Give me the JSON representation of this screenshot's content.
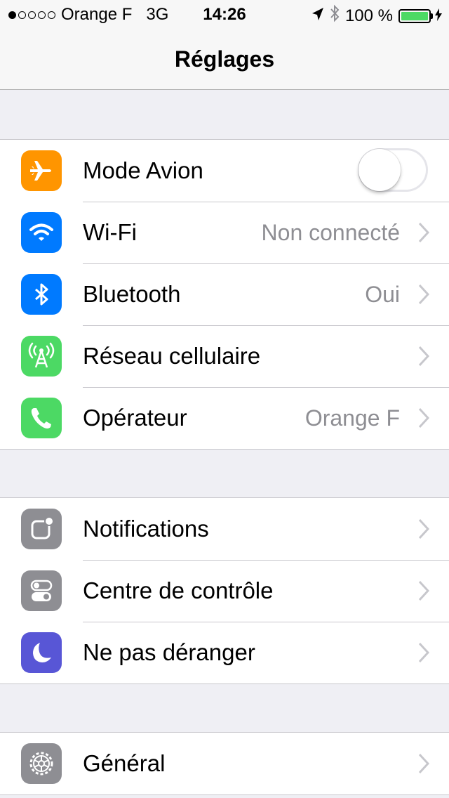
{
  "status_bar": {
    "signal_dots_filled": 1,
    "signal_dots_total": 5,
    "carrier": "Orange F",
    "network": "3G",
    "time": "14:26",
    "battery": "100 %",
    "battery_level": 1.0
  },
  "nav": {
    "title": "Réglages"
  },
  "groups": [
    {
      "rows": [
        {
          "label": "Mode Avion",
          "icon": "airplane-icon",
          "color": "#ff9500",
          "toggle": false
        },
        {
          "label": "Wi-Fi",
          "icon": "wifi-icon",
          "color": "#007aff",
          "detail": "Non connecté"
        },
        {
          "label": "Bluetooth",
          "icon": "bluetooth-icon",
          "color": "#007aff",
          "detail": "Oui"
        },
        {
          "label": "Réseau cellulaire",
          "icon": "cellular-antenna-icon",
          "color": "#4cd964"
        },
        {
          "label": "Opérateur",
          "icon": "phone-icon",
          "color": "#4cd964",
          "detail": "Orange F"
        }
      ]
    },
    {
      "rows": [
        {
          "label": "Notifications",
          "icon": "notifications-icon",
          "color": "#8e8e93"
        },
        {
          "label": "Centre de contrôle",
          "icon": "control-center-icon",
          "color": "#8e8e93"
        },
        {
          "label": "Ne pas déranger",
          "icon": "moon-icon",
          "color": "#5856d6"
        }
      ]
    },
    {
      "rows": [
        {
          "label": "Général",
          "icon": "gear-icon",
          "color": "#8e8e93"
        }
      ]
    }
  ]
}
